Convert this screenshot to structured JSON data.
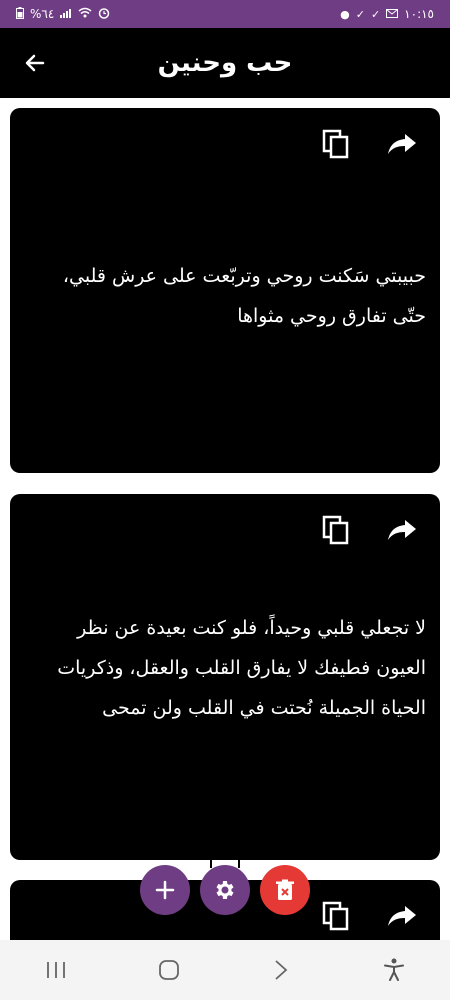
{
  "status_bar": {
    "time": "١٠:١٥",
    "battery": "%٦٤"
  },
  "header": {
    "title": "حب وحنين"
  },
  "cards": [
    {
      "text": "حبيبتي سَكنت روحي وتربّعت على عرش قلبي، حتّى تفارق روحي مثواها"
    },
    {
      "text": "لا تجعلي قلبي وحيداً، فلو كنت بعيدة عن نظر العيون فطيفك لا يفارق القلب والعقل، وذكريات الحياة الجميلة نُحتت في القلب ولن تمحى"
    },
    {
      "text": ""
    }
  ],
  "colors": {
    "accent": "#6e3d83",
    "delete": "#e53935",
    "card": "#000000"
  },
  "icons": {
    "back": "arrow-left-icon",
    "copy": "copy-icon",
    "share": "share-icon",
    "add": "plus-icon",
    "settings": "gear-icon",
    "delete": "trash-icon"
  }
}
